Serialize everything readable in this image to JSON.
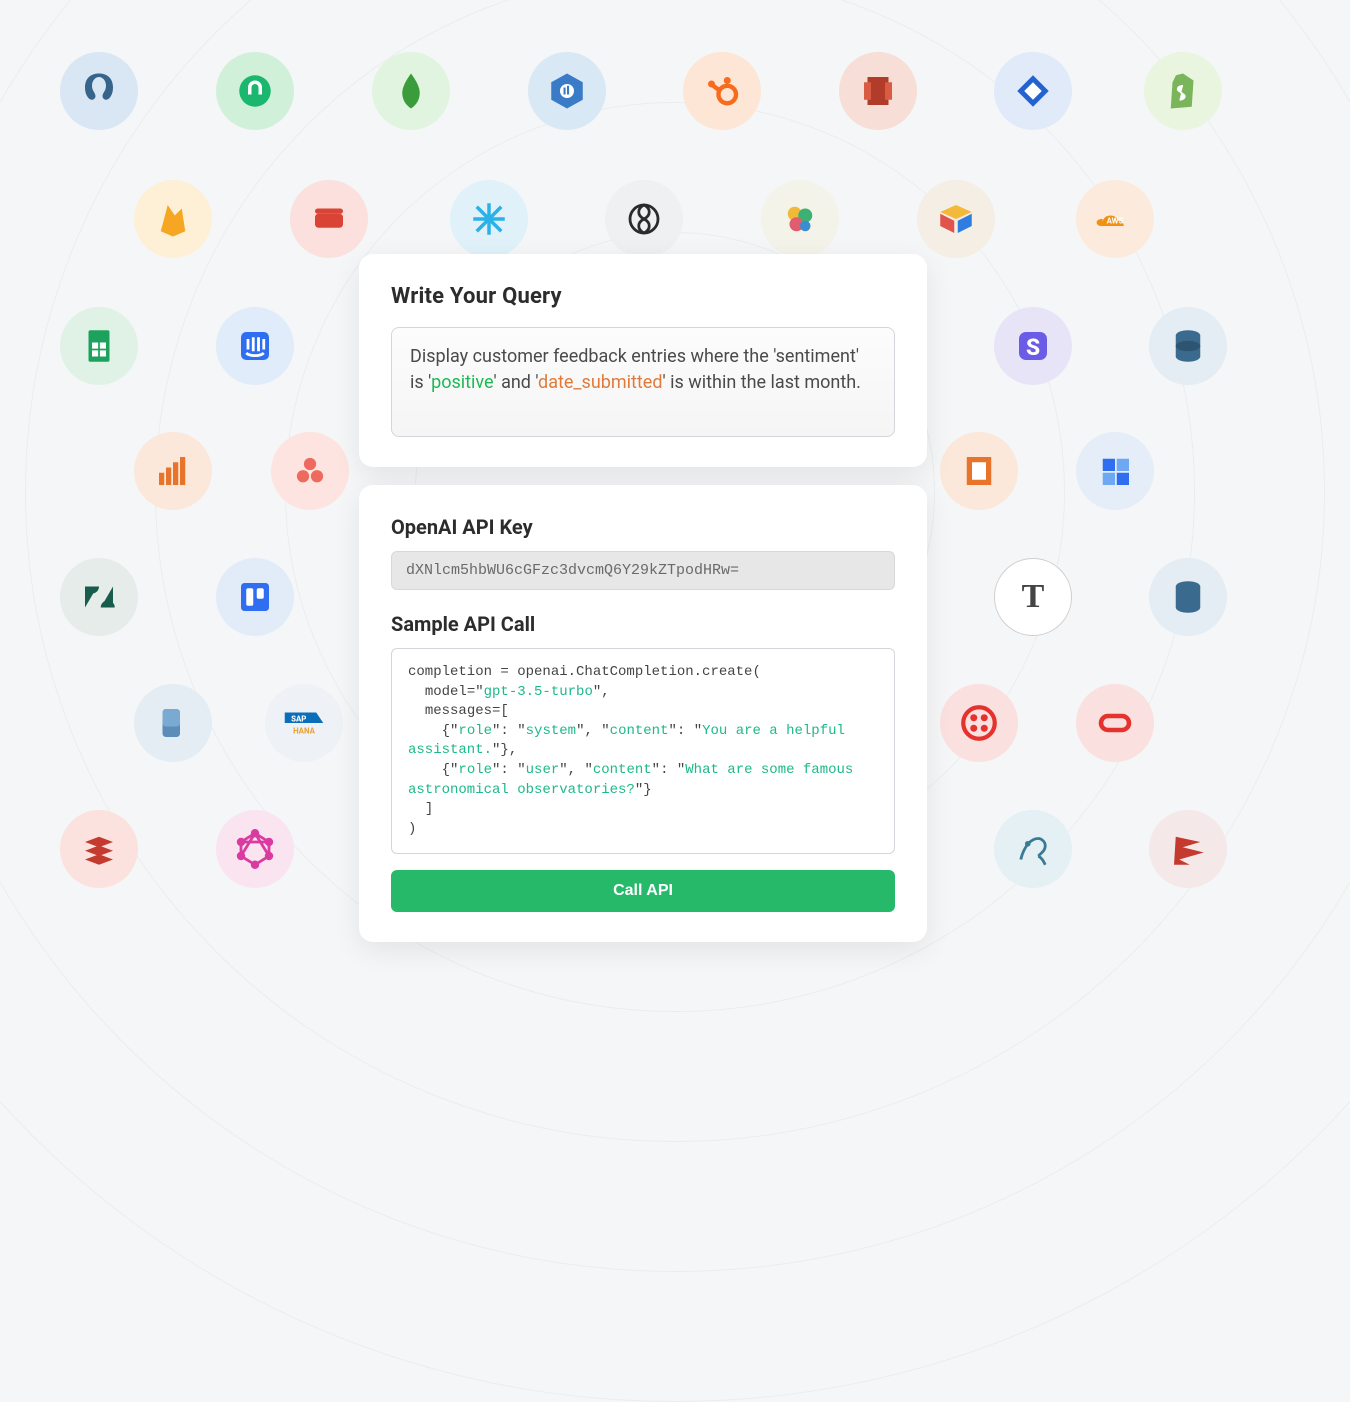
{
  "query_card": {
    "title": "Write Your Query",
    "text_pre": "Display customer feedback entries where the 'sentiment' is '",
    "hl1": "positive",
    "text_mid": "' and '",
    "hl2": "date_submitted",
    "text_post": "' is within the last month."
  },
  "api_card": {
    "key_label": "OpenAI API Key",
    "key_value": "dXNlcm5hbWU6cGFzc3dvcmQ6Y29kZTpodHRw=",
    "sample_label": "Sample API Call",
    "code": {
      "l1": "completion = openai.ChatCompletion.create(",
      "l2a": "  model=\"",
      "l2b": "gpt-3.5-turbo",
      "l2c": "\",",
      "l3": "  messages=[",
      "l4a": "    {\"",
      "l4b": "role",
      "l4c": "\": \"",
      "l4d": "system",
      "l4e": "\", \"",
      "l4f": "content",
      "l4g": "\": \"",
      "l4h": "You are a helpful assistant.",
      "l4i": "\"},",
      "l5a": "    {\"",
      "l5b": "role",
      "l5c": "\": \"",
      "l5d": "user",
      "l5e": "\", \"",
      "l5f": "content",
      "l5g": "\": \"",
      "l5h": "What are some famous astronomical observatories?",
      "l5i": "\"}",
      "l6": "  ]",
      "l7": ")"
    },
    "button": "Call API"
  },
  "integrations": {
    "row1": [
      "postgresql",
      "zendesk-support",
      "mongodb",
      "bigquery",
      "hubspot",
      "aws-redshift",
      "jira",
      "shopify"
    ],
    "row2": [
      "firebase",
      "couchbase",
      "snowflake",
      "openai",
      "elastic",
      "airtable",
      "aws"
    ],
    "row3": [
      "google-sheets",
      "intercom",
      "stripe",
      "dynamodb"
    ],
    "row4": [
      "databricks",
      "asana",
      "aws-service",
      "io-app"
    ],
    "row5": [
      "zendesk",
      "trello",
      "t-app",
      "dynamodb-alt"
    ],
    "row6": [
      "paddle",
      "sap-hana",
      "twilio",
      "oracle"
    ],
    "row7": [
      "redis",
      "graphql",
      "mysql",
      "sql-server"
    ]
  }
}
